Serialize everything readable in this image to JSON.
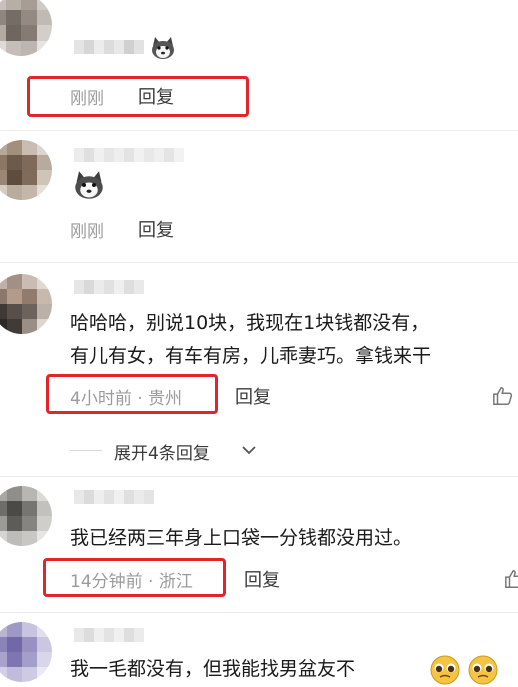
{
  "comments": [
    {
      "time": "刚刚",
      "reply_label": "回复",
      "sticker": "husky-sticker-icon"
    },
    {
      "time": "刚刚",
      "reply_label": "回复",
      "sticker": "husky-sticker-icon"
    },
    {
      "line1": "哈哈哈，别说10块，我现在1块钱都没有，",
      "line2": "有儿有女，有车有房，儿乖妻巧。拿钱来干",
      "meta": "4小时前 · 贵州",
      "reply_label": "回复",
      "expand_label": "展开4条回复",
      "like": "thumb-up-icon"
    },
    {
      "line1": "我已经两三年身上口袋一分钱都没用过。",
      "meta": "14分钟前 · 浙江",
      "reply_label": "回复",
      "like": "thumb-up-icon"
    },
    {
      "line1": "我一毛都没有，但我能找男盆友不",
      "emoji": "pleading-face-emoji"
    }
  ],
  "colors": {
    "highlight": "#e0262b",
    "meta_text": "#9b9b9b",
    "body_text": "#1a1a1a"
  }
}
